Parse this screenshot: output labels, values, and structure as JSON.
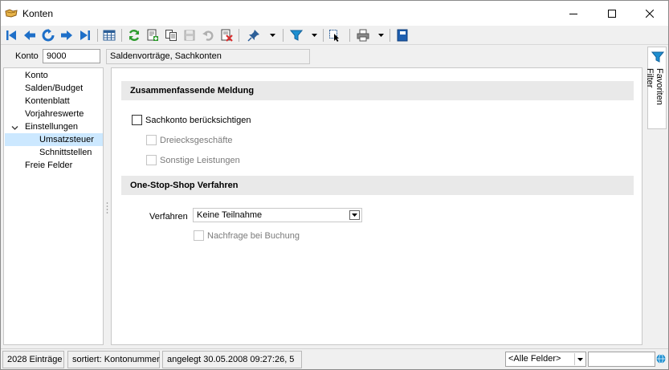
{
  "window": {
    "title": "Konten"
  },
  "toolbar": {
    "buttons": [
      {
        "name": "first-record",
        "icon": "skip-first-icon"
      },
      {
        "name": "previous-record",
        "icon": "arrow-left-icon"
      },
      {
        "name": "refresh-record",
        "icon": "circular-arrow-icon"
      },
      {
        "name": "next-record",
        "icon": "arrow-right-icon"
      },
      {
        "name": "last-record",
        "icon": "skip-last-icon"
      },
      {
        "name": "table-view",
        "icon": "table-icon"
      },
      {
        "name": "reload",
        "icon": "reload-icon"
      },
      {
        "name": "new-record",
        "icon": "new-document-icon"
      },
      {
        "name": "copy-record",
        "icon": "copy-icon"
      },
      {
        "name": "save-record",
        "icon": "save-icon"
      },
      {
        "name": "undo",
        "icon": "undo-icon"
      },
      {
        "name": "delete-record",
        "icon": "delete-icon"
      },
      {
        "name": "pin",
        "icon": "pin-icon"
      },
      {
        "name": "filter",
        "icon": "filter-icon"
      },
      {
        "name": "select-cursor",
        "icon": "cursor-select-icon"
      },
      {
        "name": "print",
        "icon": "printer-icon"
      },
      {
        "name": "book",
        "icon": "book-icon"
      }
    ]
  },
  "konto": {
    "label": "Konto",
    "value": "9000",
    "description": "Saldenvorträge, Sachkonten"
  },
  "nav": {
    "items": [
      {
        "label": "Konto"
      },
      {
        "label": "Salden/Budget"
      },
      {
        "label": "Kontenblatt"
      },
      {
        "label": "Vorjahreswerte"
      },
      {
        "label": "Einstellungen"
      },
      {
        "label": "Umsatzsteuer"
      },
      {
        "label": "Schnittstellen"
      },
      {
        "label": "Freie Felder"
      }
    ]
  },
  "content": {
    "section1": {
      "title": "Zusammenfassende Meldung",
      "checkbox_main": "Sachkonto berücksichtigen",
      "checkbox_sub1": "Dreiecksgeschäfte",
      "checkbox_sub2": "Sonstige Leistungen"
    },
    "section2": {
      "title": "One-Stop-Shop Verfahren",
      "verfahren_label": "Verfahren",
      "verfahren_value": "Keine Teilnahme",
      "checkbox_nachfrage": "Nachfrage bei Buchung"
    }
  },
  "favorites": {
    "label": "Favoriten Filter"
  },
  "status": {
    "entries": "2028 Einträge",
    "sort": "sortiert: Kontonummer",
    "created": "angelegt 30.05.2008 09:27:26,  5",
    "field_filter": "<Alle Felder>",
    "search_value": ""
  },
  "colors": {
    "accent_blue": "#1e6fc8",
    "selection": "#cce8ff",
    "section_bg": "#e9e9e9",
    "reload_green": "#2e9b2e",
    "delete_red": "#d83030"
  }
}
